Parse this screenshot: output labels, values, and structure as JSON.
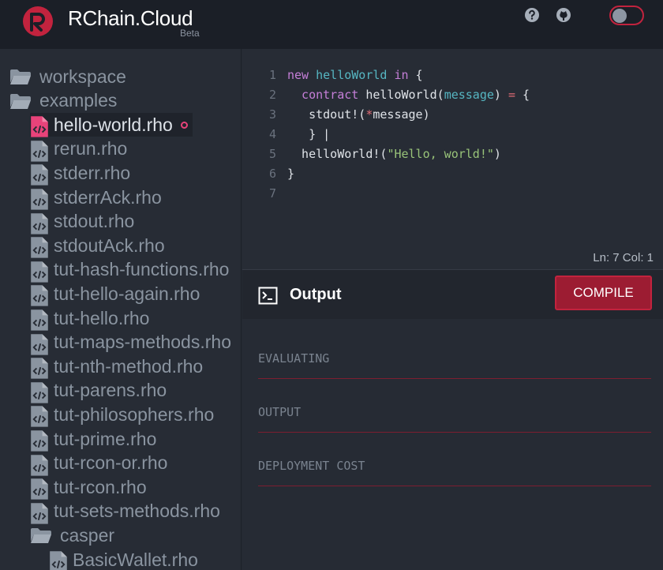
{
  "header": {
    "brand": "RChain.Cloud",
    "beta": "Beta",
    "help_icon": "help-circle-icon",
    "github_icon": "github-icon",
    "accent": "#c2233e"
  },
  "sidebar": {
    "folders": [
      {
        "label": "workspace"
      },
      {
        "label": "examples"
      }
    ],
    "files": [
      {
        "label": "hello-world.rho",
        "active": true
      },
      {
        "label": "rerun.rho"
      },
      {
        "label": "stderr.rho"
      },
      {
        "label": "stderrAck.rho"
      },
      {
        "label": "stdout.rho"
      },
      {
        "label": "stdoutAck.rho"
      },
      {
        "label": "tut-hash-functions.rho"
      },
      {
        "label": "tut-hello-again.rho"
      },
      {
        "label": "tut-hello.rho"
      },
      {
        "label": "tut-maps-methods.rho"
      },
      {
        "label": "tut-nth-method.rho"
      },
      {
        "label": "tut-parens.rho"
      },
      {
        "label": "tut-philosophers.rho"
      },
      {
        "label": "tut-prime.rho"
      },
      {
        "label": "tut-rcon-or.rho"
      },
      {
        "label": "tut-rcon.rho"
      },
      {
        "label": "tut-sets-methods.rho"
      }
    ],
    "subfolder": {
      "label": "casper"
    },
    "subfiles": [
      {
        "label": "BasicWallet.rho"
      }
    ]
  },
  "editor": {
    "lines": [
      {
        "n": "1",
        "parts": [
          [
            "kw",
            "new "
          ],
          [
            "ty",
            "helloWorld"
          ],
          [
            "kw",
            " in"
          ],
          [
            "code",
            " {"
          ]
        ]
      },
      {
        "n": "2",
        "parts": [
          [
            "kw",
            "  contract"
          ],
          [
            "code",
            " helloWorld("
          ],
          [
            "ty",
            "message"
          ],
          [
            "code",
            ") "
          ],
          [
            "op",
            "="
          ],
          [
            "code",
            " {"
          ]
        ]
      },
      {
        "n": "3",
        "parts": [
          [
            "code",
            "   stdout!("
          ],
          [
            "op",
            "*"
          ],
          [
            "code",
            "message)"
          ]
        ]
      },
      {
        "n": "4",
        "parts": [
          [
            "code",
            "   } |"
          ]
        ]
      },
      {
        "n": "5",
        "parts": [
          [
            "code",
            "  helloWorld!("
          ],
          [
            "str",
            "\"Hello, world!\""
          ],
          [
            "code",
            ")"
          ]
        ]
      },
      {
        "n": "6",
        "parts": [
          [
            "code",
            "}"
          ]
        ]
      },
      {
        "n": "7",
        "parts": []
      }
    ],
    "status": "Ln: 7 Col: 1"
  },
  "output": {
    "title": "Output",
    "compile_label": "COMPILE",
    "sections": [
      "EVALUATING",
      "OUTPUT",
      "DEPLOYMENT COST"
    ]
  }
}
